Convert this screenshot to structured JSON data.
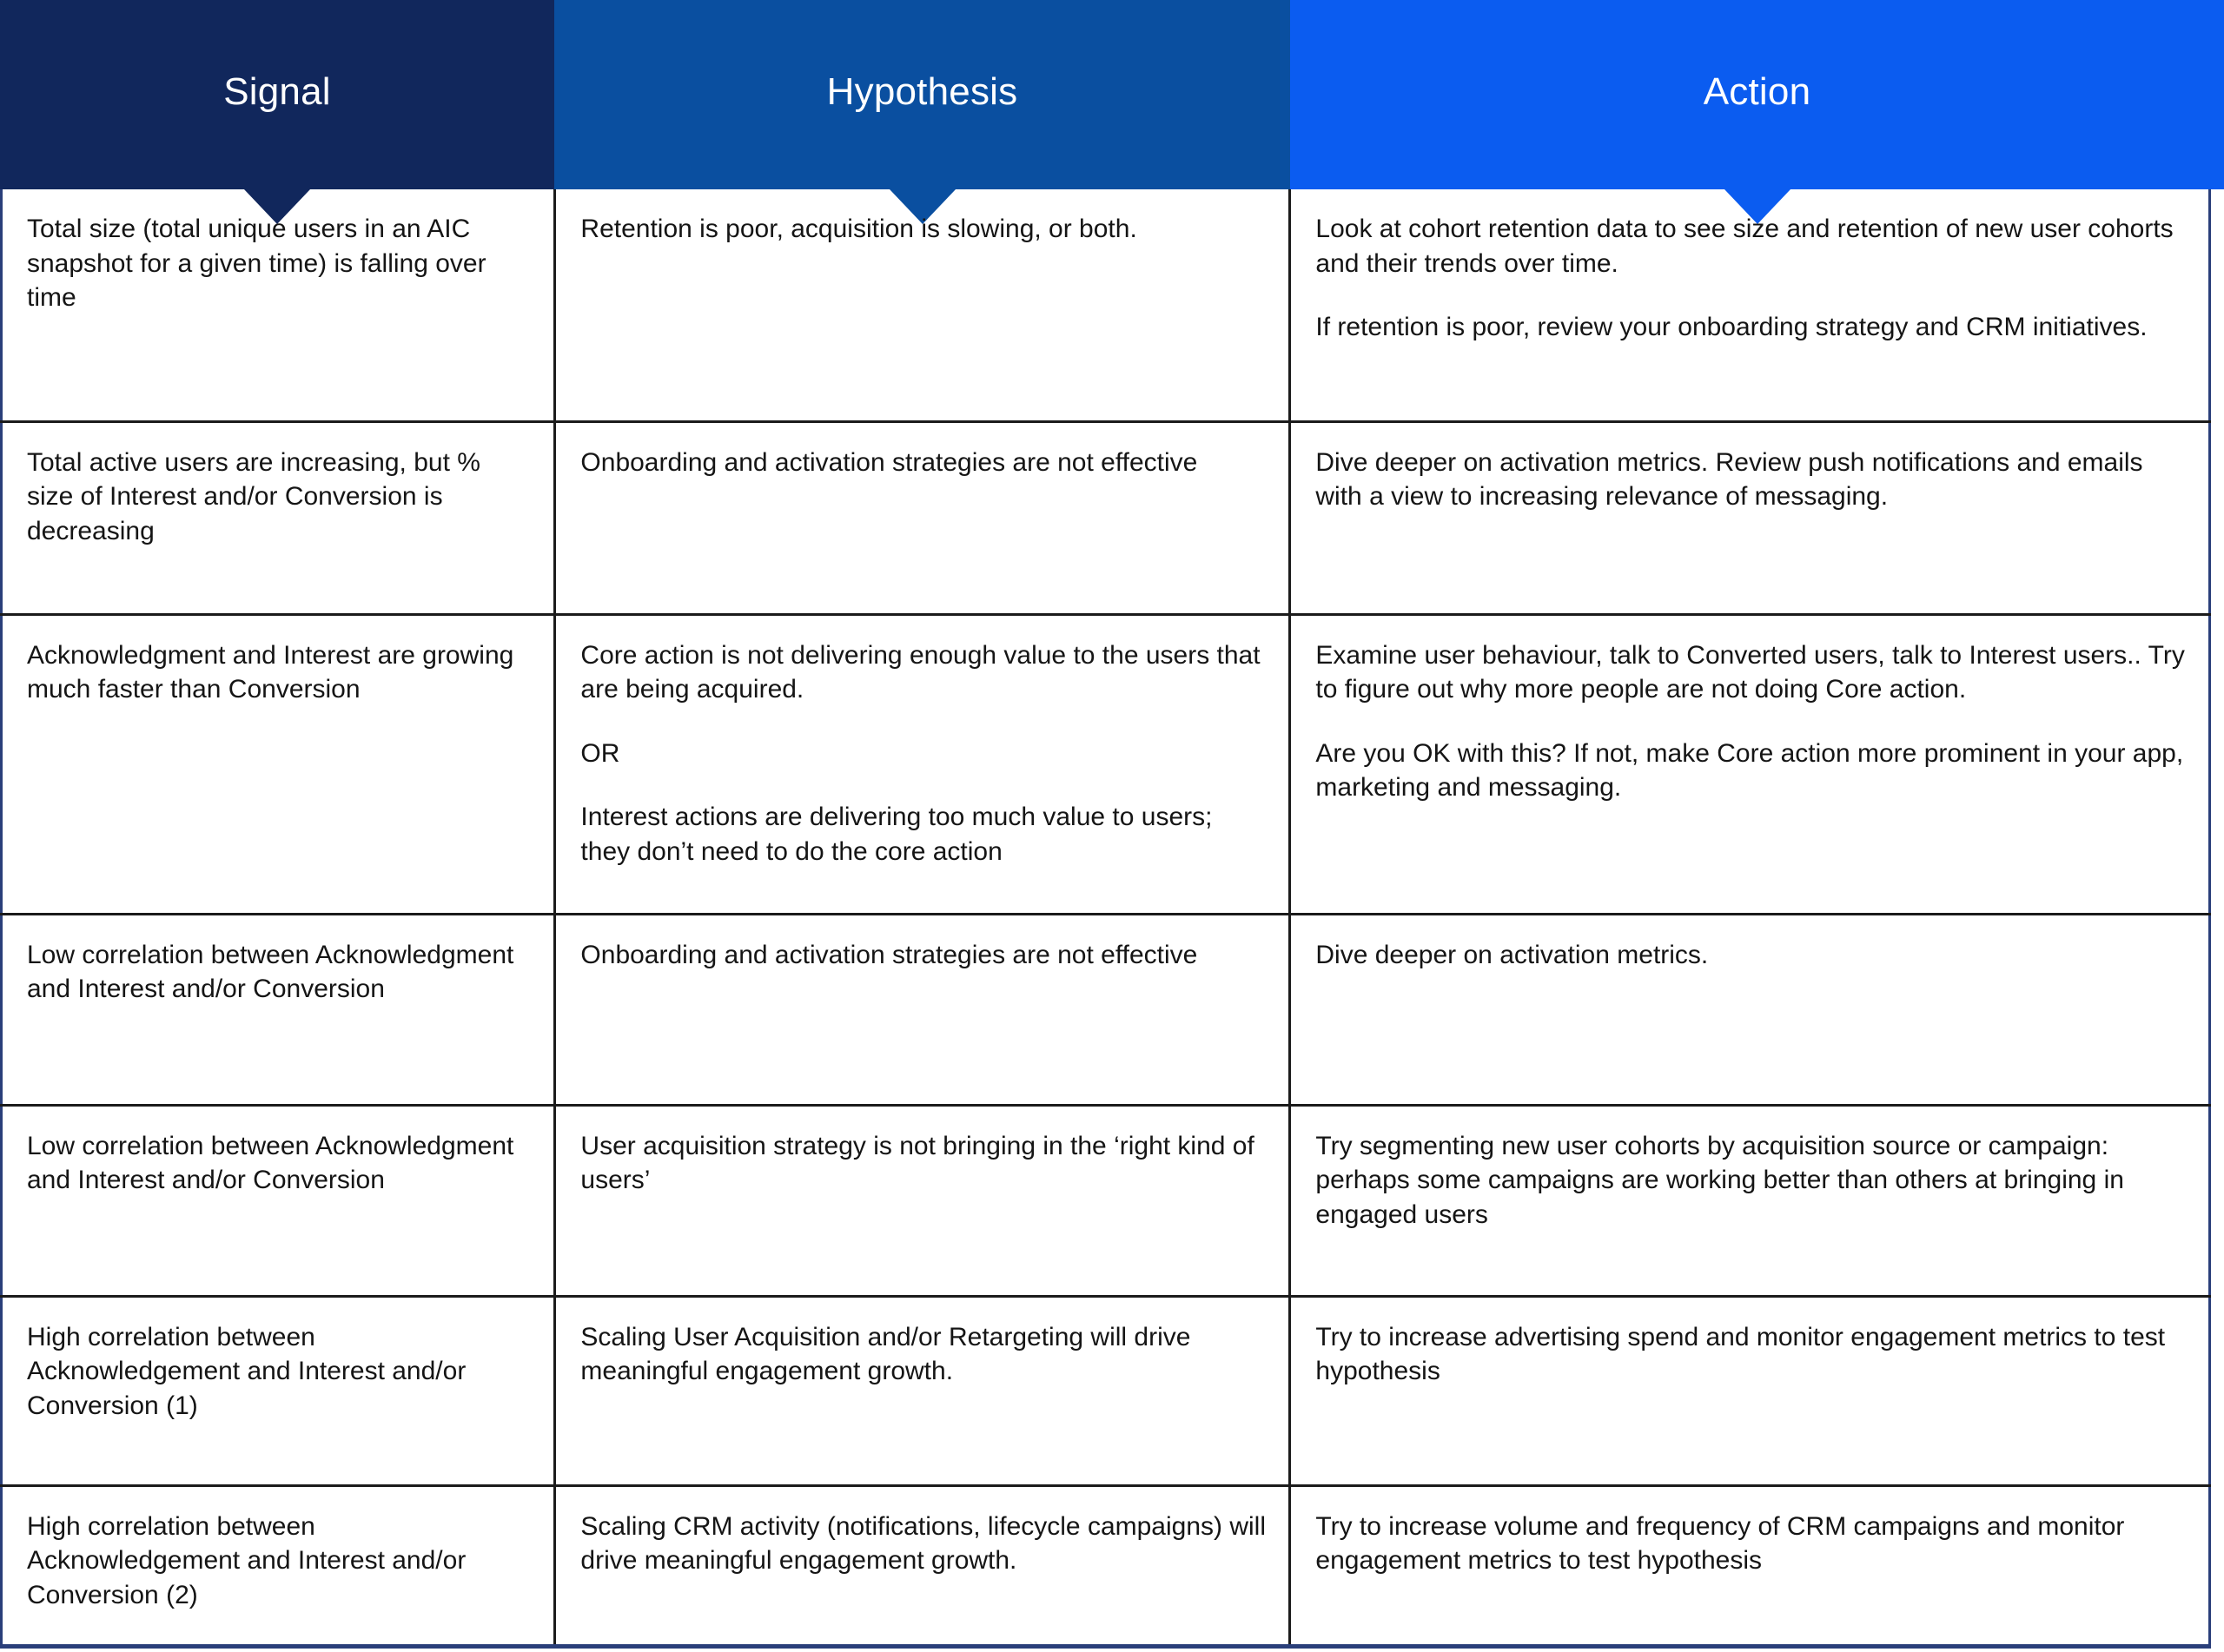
{
  "table": {
    "columns": [
      {
        "key": "signal",
        "label": "Signal",
        "color": "#11275c"
      },
      {
        "key": "hypothesis",
        "label": "Hypothesis",
        "color": "#0a4fa0"
      },
      {
        "key": "action",
        "label": "Action",
        "color": "#0b5cf0"
      }
    ],
    "rows": [
      {
        "signal": "Total size (total unique users in an AIC snapshot for a given time) is falling over time",
        "hypothesis": "Retention is poor, acquisition is slowing, or both.",
        "action_p1": "Look at cohort retention data to see size and retention of new user cohorts and their trends over time.",
        "action_p2": "If retention is poor, review your onboarding strategy and CRM initiatives."
      },
      {
        "signal": "Total active users are increasing, but % size of Interest and/or Conversion is decreasing",
        "hypothesis": "Onboarding and activation strategies are not effective",
        "action_p1": "Dive deeper on activation metrics. Review push notifications and emails with a view to increasing relevance of messaging.",
        "action_p2": ""
      },
      {
        "signal": "Acknowledgment and Interest are growing much faster than Conversion",
        "hypothesis_p1": "Core action is not delivering enough value to the users that are being acquired.",
        "hypothesis_or": "OR",
        "hypothesis_p2": "Interest actions are delivering too much value to users; they don’t need to do the core action",
        "action_p1": "Examine user behaviour, talk to Converted users, talk to Interest users.. Try to figure out why more people are not doing Core action.",
        "action_p2": "Are you OK with this? If not, make Core action more prominent in your app, marketing and messaging."
      },
      {
        "signal": "Low correlation between Acknowledgment and Interest and/or Conversion",
        "hypothesis": "Onboarding and activation strategies are not effective",
        "action_p1": "Dive deeper on activation metrics.",
        "action_p2": ""
      },
      {
        "signal": "Low correlation between Acknowledgment and Interest and/or Conversion",
        "hypothesis": "User acquisition strategy is not bringing in the ‘right kind of users’",
        "action_p1": "Try segmenting new user cohorts by acquisition source or campaign: perhaps some campaigns are working better than others at bringing in engaged users",
        "action_p2": ""
      },
      {
        "signal": "High correlation between Acknowledgement and Interest and/or Conversion (1)",
        "hypothesis": "Scaling User Acquisition and/or Retargeting will drive meaningful engagement growth.",
        "action_p1": "Try to increase advertising spend and monitor engagement metrics to test hypothesis",
        "action_p2": ""
      },
      {
        "signal": "High correlation between Acknowledgement and Interest and/or Conversion (2)",
        "hypothesis": "Scaling CRM activity (notifications, lifecycle campaigns) will drive meaningful engagement growth.",
        "action_p1": "Try to increase volume and frequency of CRM campaigns and monitor engagement metrics to test hypothesis",
        "action_p2": ""
      }
    ]
  }
}
